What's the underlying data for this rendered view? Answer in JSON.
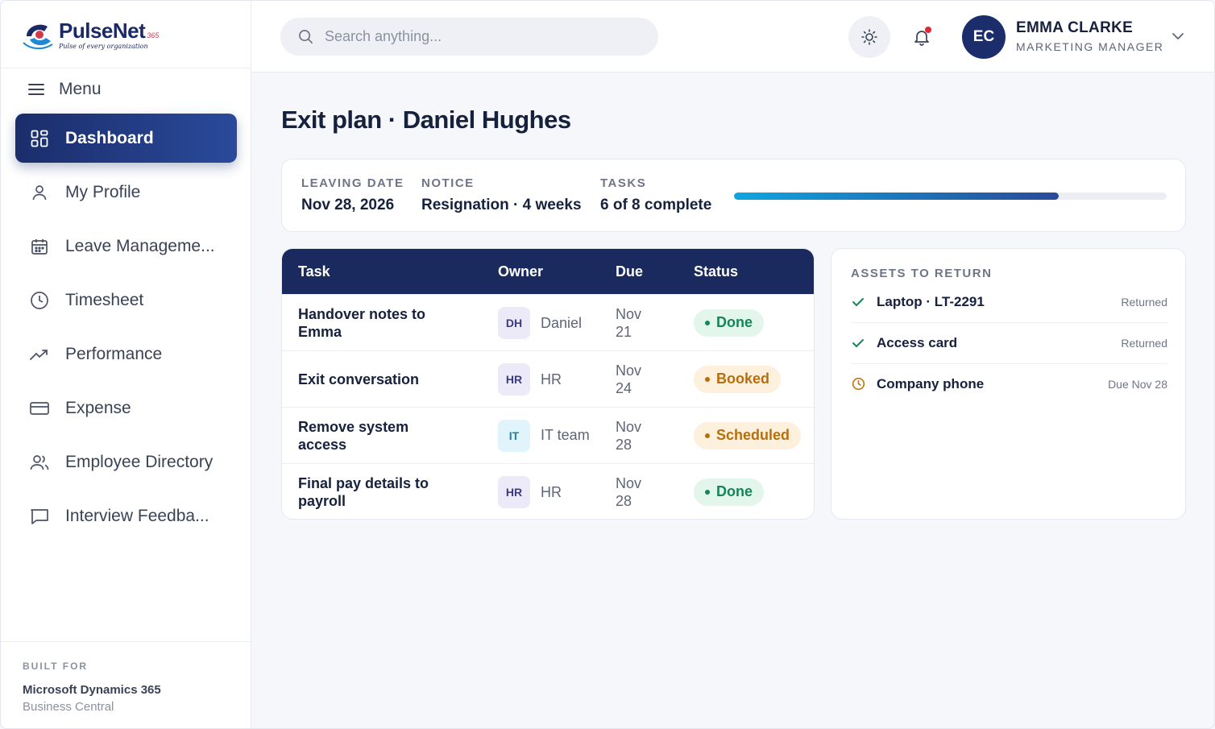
{
  "brand": {
    "name": "PulseNet",
    "suffix": "365",
    "tagline": "Pulse of every organization"
  },
  "sidebar": {
    "menu_label": "Menu",
    "items": [
      {
        "label": "Dashboard",
        "icon": "grid-icon",
        "active": true
      },
      {
        "label": "My Profile",
        "icon": "user-icon"
      },
      {
        "label": "Leave Manageme...",
        "icon": "calendar-icon"
      },
      {
        "label": "Timesheet",
        "icon": "clock-icon"
      },
      {
        "label": "Performance",
        "icon": "trend-icon"
      },
      {
        "label": "Expense",
        "icon": "card-icon"
      },
      {
        "label": "Employee Directory",
        "icon": "users-icon"
      },
      {
        "label": "Interview Feedba...",
        "icon": "chat-icon"
      }
    ],
    "built_for": {
      "label": "BUILT FOR",
      "line1": "Microsoft Dynamics 365",
      "line2": "Business Central"
    }
  },
  "topbar": {
    "search_placeholder": "Search anything...",
    "user": {
      "initials": "EC",
      "name": "EMMA CLARKE",
      "role": "MARKETING MANAGER"
    }
  },
  "page": {
    "title": "Exit plan · Daniel Hughes"
  },
  "summary": {
    "leaving_date_label": "LEAVING DATE",
    "leaving_date": "Nov 28, 2026",
    "notice_label": "NOTICE",
    "notice": "Resignation · 4 weeks",
    "tasks_label": "TASKS",
    "tasks": "6 of 8 complete",
    "progress_fraction": 0.75
  },
  "tasks_table": {
    "headers": {
      "task": "Task",
      "owner": "Owner",
      "due": "Due",
      "status": "Status"
    },
    "rows": [
      {
        "task": "Handover notes to Emma",
        "owner_initials": "DH",
        "owner": "Daniel",
        "due_month": "Nov",
        "due_day": "21",
        "status": "Done",
        "status_kind": "done"
      },
      {
        "task": "Exit conversation",
        "owner_initials": "HR",
        "owner": "HR",
        "due_month": "Nov",
        "due_day": "24",
        "status": "Booked",
        "status_kind": "warn"
      },
      {
        "task": "Remove system access",
        "owner_initials": "IT",
        "owner": "IT team",
        "due_month": "Nov",
        "due_day": "28",
        "status": "Scheduled",
        "status_kind": "warn"
      },
      {
        "task": "Final pay details to payroll",
        "owner_initials": "HR",
        "owner": "HR",
        "due_month": "Nov",
        "due_day": "28",
        "status": "Done",
        "status_kind": "done"
      }
    ]
  },
  "assets": {
    "title": "ASSETS TO RETURN",
    "items": [
      {
        "name": "Laptop · LT-2291",
        "state": "Returned",
        "icon": "check-icon"
      },
      {
        "name": "Access card",
        "state": "Returned",
        "icon": "check-icon"
      },
      {
        "name": "Company phone",
        "state": "Due Nov 28",
        "icon": "clock-icon"
      }
    ]
  },
  "colors": {
    "primary": "#1b2d6b",
    "success": "#17845a",
    "warning": "#b86e0c",
    "notify": "#e0273a"
  }
}
